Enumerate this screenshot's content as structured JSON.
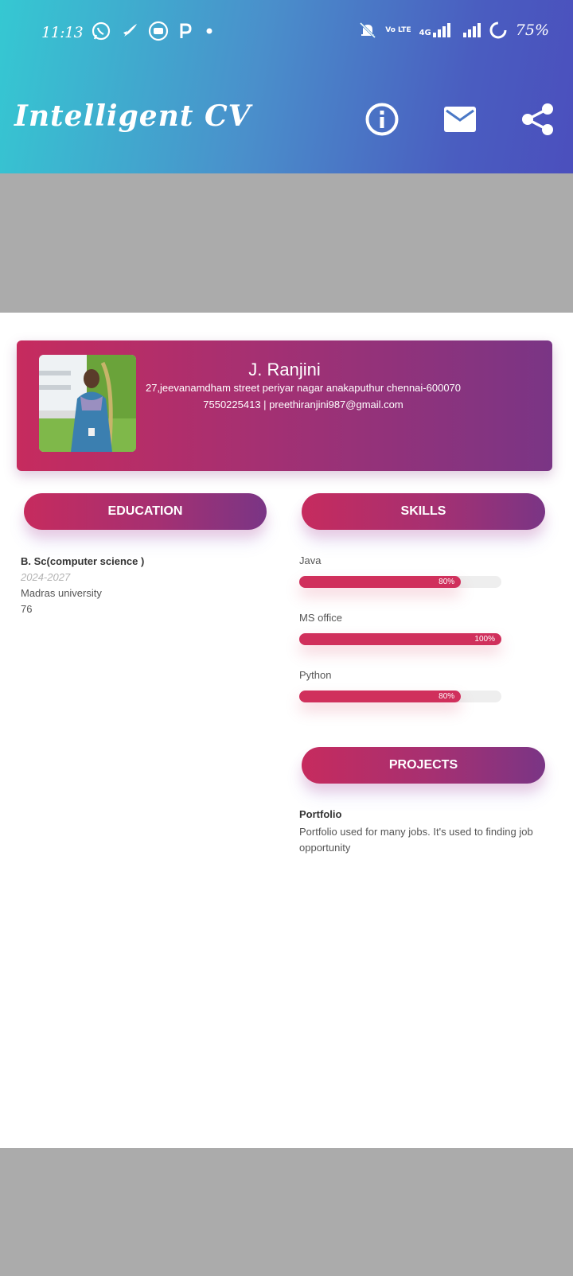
{
  "status_bar": {
    "time": "11:13",
    "volte": "Vo LTE",
    "network": "4G",
    "battery": "75%"
  },
  "app_bar": {
    "title": "Intelligent CV",
    "actions": [
      "info-icon",
      "mail-icon",
      "share-icon"
    ]
  },
  "resume": {
    "name": "J. Ranjini",
    "address": "27,jeevanamdham street periyar nagar anakaputhur chennai-600070",
    "contact": "7550225413 | preethiranjini987@gmail.com",
    "sections": {
      "education": "EDUCATION",
      "skills": "SKILLS",
      "projects": "PROJECTS"
    },
    "education": {
      "degree": "B. Sc(computer science )",
      "years": "2024-2027",
      "university": "Madras university",
      "score": "76"
    },
    "skills": [
      {
        "name": "Java",
        "level": 80,
        "level_label": "80%"
      },
      {
        "name": "MS office",
        "level": 100,
        "level_label": "100%"
      },
      {
        "name": "Python",
        "level": 80,
        "level_label": "80%"
      }
    ],
    "project": {
      "title": "Portfolio",
      "description": "Portfolio used for many jobs. It's used  to finding job opportunity"
    }
  },
  "colors": {
    "accent_start": "#c62b5e",
    "accent_end": "#7a3585",
    "topbar_start": "#35c8d2",
    "topbar_end": "#4b4fbd",
    "gray_band": "#ababab"
  }
}
